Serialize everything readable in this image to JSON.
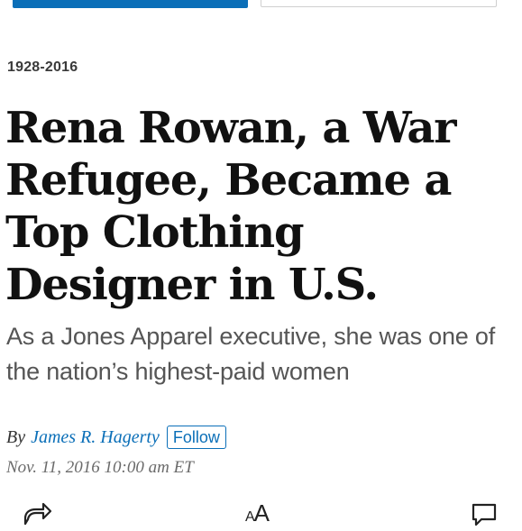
{
  "top_tabs": [
    {
      "label": ""
    },
    {
      "label": ""
    }
  ],
  "article": {
    "kicker": "1928-2016",
    "headline": "Rena Rowan, a War Refugee, Became a Top Clothing Designer in U.S.",
    "dek": "As a Jones Apparel executive, she was one of the nation’s highest-paid women",
    "byline": {
      "prefix": "By",
      "author": "James R. Hagerty",
      "follow_label": "Follow"
    },
    "timestamp": "Nov. 11, 2016 10:00 am ET"
  },
  "toolbar": {
    "share_icon": "share-icon",
    "text_size": {
      "small": "A",
      "large": "A"
    },
    "comments_icon": "comments-icon"
  },
  "colors": {
    "accent": "#0b6fb8",
    "headline": "#111111",
    "dek": "#555555",
    "timestamp": "#6b6b6b"
  }
}
